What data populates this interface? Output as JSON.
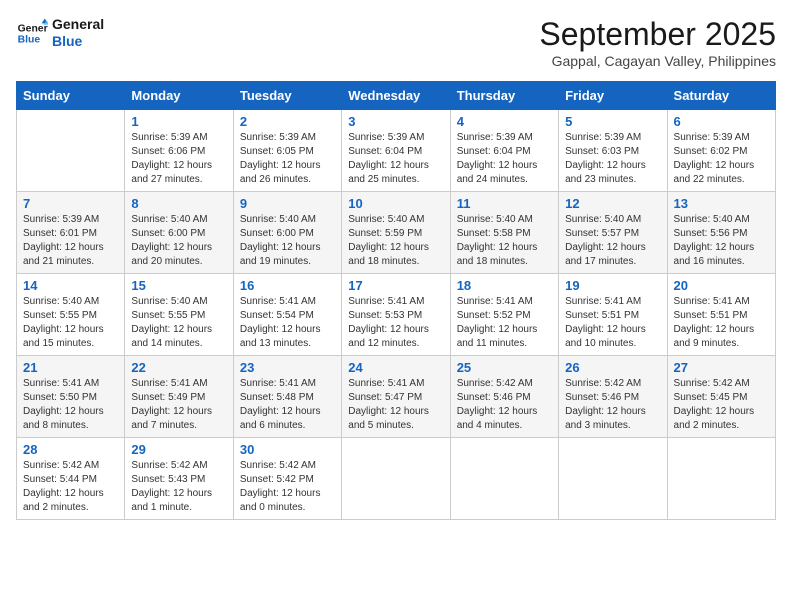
{
  "logo": {
    "line1": "General",
    "line2": "Blue"
  },
  "title": "September 2025",
  "subtitle": "Gappal, Cagayan Valley, Philippines",
  "headers": [
    "Sunday",
    "Monday",
    "Tuesday",
    "Wednesday",
    "Thursday",
    "Friday",
    "Saturday"
  ],
  "weeks": [
    [
      {
        "day": "",
        "sunrise": "",
        "sunset": "",
        "daylight": ""
      },
      {
        "day": "1",
        "sunrise": "Sunrise: 5:39 AM",
        "sunset": "Sunset: 6:06 PM",
        "daylight": "Daylight: 12 hours and 27 minutes."
      },
      {
        "day": "2",
        "sunrise": "Sunrise: 5:39 AM",
        "sunset": "Sunset: 6:05 PM",
        "daylight": "Daylight: 12 hours and 26 minutes."
      },
      {
        "day": "3",
        "sunrise": "Sunrise: 5:39 AM",
        "sunset": "Sunset: 6:04 PM",
        "daylight": "Daylight: 12 hours and 25 minutes."
      },
      {
        "day": "4",
        "sunrise": "Sunrise: 5:39 AM",
        "sunset": "Sunset: 6:04 PM",
        "daylight": "Daylight: 12 hours and 24 minutes."
      },
      {
        "day": "5",
        "sunrise": "Sunrise: 5:39 AM",
        "sunset": "Sunset: 6:03 PM",
        "daylight": "Daylight: 12 hours and 23 minutes."
      },
      {
        "day": "6",
        "sunrise": "Sunrise: 5:39 AM",
        "sunset": "Sunset: 6:02 PM",
        "daylight": "Daylight: 12 hours and 22 minutes."
      }
    ],
    [
      {
        "day": "7",
        "sunrise": "Sunrise: 5:39 AM",
        "sunset": "Sunset: 6:01 PM",
        "daylight": "Daylight: 12 hours and 21 minutes."
      },
      {
        "day": "8",
        "sunrise": "Sunrise: 5:40 AM",
        "sunset": "Sunset: 6:00 PM",
        "daylight": "Daylight: 12 hours and 20 minutes."
      },
      {
        "day": "9",
        "sunrise": "Sunrise: 5:40 AM",
        "sunset": "Sunset: 6:00 PM",
        "daylight": "Daylight: 12 hours and 19 minutes."
      },
      {
        "day": "10",
        "sunrise": "Sunrise: 5:40 AM",
        "sunset": "Sunset: 5:59 PM",
        "daylight": "Daylight: 12 hours and 18 minutes."
      },
      {
        "day": "11",
        "sunrise": "Sunrise: 5:40 AM",
        "sunset": "Sunset: 5:58 PM",
        "daylight": "Daylight: 12 hours and 18 minutes."
      },
      {
        "day": "12",
        "sunrise": "Sunrise: 5:40 AM",
        "sunset": "Sunset: 5:57 PM",
        "daylight": "Daylight: 12 hours and 17 minutes."
      },
      {
        "day": "13",
        "sunrise": "Sunrise: 5:40 AM",
        "sunset": "Sunset: 5:56 PM",
        "daylight": "Daylight: 12 hours and 16 minutes."
      }
    ],
    [
      {
        "day": "14",
        "sunrise": "Sunrise: 5:40 AM",
        "sunset": "Sunset: 5:55 PM",
        "daylight": "Daylight: 12 hours and 15 minutes."
      },
      {
        "day": "15",
        "sunrise": "Sunrise: 5:40 AM",
        "sunset": "Sunset: 5:55 PM",
        "daylight": "Daylight: 12 hours and 14 minutes."
      },
      {
        "day": "16",
        "sunrise": "Sunrise: 5:41 AM",
        "sunset": "Sunset: 5:54 PM",
        "daylight": "Daylight: 12 hours and 13 minutes."
      },
      {
        "day": "17",
        "sunrise": "Sunrise: 5:41 AM",
        "sunset": "Sunset: 5:53 PM",
        "daylight": "Daylight: 12 hours and 12 minutes."
      },
      {
        "day": "18",
        "sunrise": "Sunrise: 5:41 AM",
        "sunset": "Sunset: 5:52 PM",
        "daylight": "Daylight: 12 hours and 11 minutes."
      },
      {
        "day": "19",
        "sunrise": "Sunrise: 5:41 AM",
        "sunset": "Sunset: 5:51 PM",
        "daylight": "Daylight: 12 hours and 10 minutes."
      },
      {
        "day": "20",
        "sunrise": "Sunrise: 5:41 AM",
        "sunset": "Sunset: 5:51 PM",
        "daylight": "Daylight: 12 hours and 9 minutes."
      }
    ],
    [
      {
        "day": "21",
        "sunrise": "Sunrise: 5:41 AM",
        "sunset": "Sunset: 5:50 PM",
        "daylight": "Daylight: 12 hours and 8 minutes."
      },
      {
        "day": "22",
        "sunrise": "Sunrise: 5:41 AM",
        "sunset": "Sunset: 5:49 PM",
        "daylight": "Daylight: 12 hours and 7 minutes."
      },
      {
        "day": "23",
        "sunrise": "Sunrise: 5:41 AM",
        "sunset": "Sunset: 5:48 PM",
        "daylight": "Daylight: 12 hours and 6 minutes."
      },
      {
        "day": "24",
        "sunrise": "Sunrise: 5:41 AM",
        "sunset": "Sunset: 5:47 PM",
        "daylight": "Daylight: 12 hours and 5 minutes."
      },
      {
        "day": "25",
        "sunrise": "Sunrise: 5:42 AM",
        "sunset": "Sunset: 5:46 PM",
        "daylight": "Daylight: 12 hours and 4 minutes."
      },
      {
        "day": "26",
        "sunrise": "Sunrise: 5:42 AM",
        "sunset": "Sunset: 5:46 PM",
        "daylight": "Daylight: 12 hours and 3 minutes."
      },
      {
        "day": "27",
        "sunrise": "Sunrise: 5:42 AM",
        "sunset": "Sunset: 5:45 PM",
        "daylight": "Daylight: 12 hours and 2 minutes."
      }
    ],
    [
      {
        "day": "28",
        "sunrise": "Sunrise: 5:42 AM",
        "sunset": "Sunset: 5:44 PM",
        "daylight": "Daylight: 12 hours and 2 minutes."
      },
      {
        "day": "29",
        "sunrise": "Sunrise: 5:42 AM",
        "sunset": "Sunset: 5:43 PM",
        "daylight": "Daylight: 12 hours and 1 minute."
      },
      {
        "day": "30",
        "sunrise": "Sunrise: 5:42 AM",
        "sunset": "Sunset: 5:42 PM",
        "daylight": "Daylight: 12 hours and 0 minutes."
      },
      {
        "day": "",
        "sunrise": "",
        "sunset": "",
        "daylight": ""
      },
      {
        "day": "",
        "sunrise": "",
        "sunset": "",
        "daylight": ""
      },
      {
        "day": "",
        "sunrise": "",
        "sunset": "",
        "daylight": ""
      },
      {
        "day": "",
        "sunrise": "",
        "sunset": "",
        "daylight": ""
      }
    ]
  ]
}
